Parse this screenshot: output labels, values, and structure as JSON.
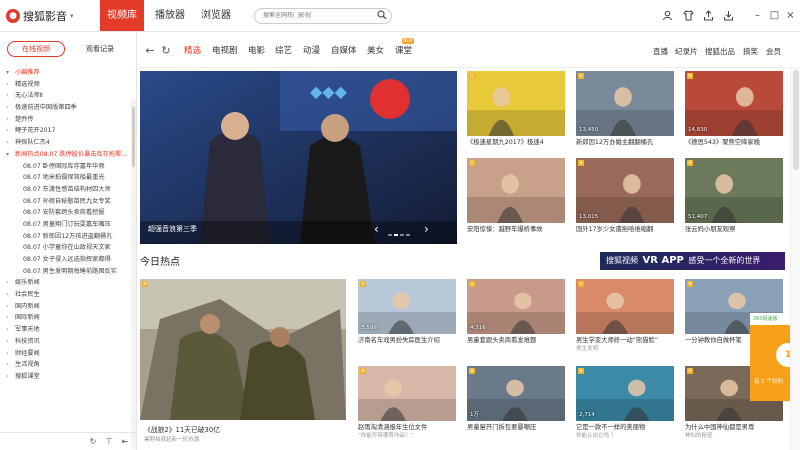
{
  "app": {
    "name": "搜狐影音",
    "nav": [
      "视频库",
      "播放器",
      "浏览器"
    ],
    "search_placeholder": "搜索全网热门影视"
  },
  "sidebar": {
    "tab_online": "在线视频",
    "tab_history": "观看记录",
    "items": [
      {
        "label": "小編推荐",
        "type": "cat",
        "arrow": "▾"
      },
      {
        "label": "精选视频",
        "type": "sub",
        "arrow": "›"
      },
      {
        "label": "无心法师Ⅱ",
        "type": "sub",
        "arrow": "›"
      },
      {
        "label": "极速前进中国版第四季",
        "type": "sub",
        "arrow": "›"
      },
      {
        "label": "楚乔传",
        "type": "sub",
        "arrow": "›"
      },
      {
        "label": "鲤子花开2017",
        "type": "sub",
        "arrow": "›"
      },
      {
        "label": "神探队仁杰4",
        "type": "sub",
        "arrow": "›"
      },
      {
        "label": "新闻热点08.07 跌停股价暴击库存拖累...",
        "type": "hl",
        "arrow": "▾"
      },
      {
        "label": "08.07 卧停国际库存嘉年华频",
        "type": "sub2",
        "arrow": ""
      },
      {
        "label": "08.07 地米拍摄保驾船最重光",
        "type": "sub2",
        "arrow": ""
      },
      {
        "label": "08.07 东渡性感苗结构材四大师",
        "type": "sub2",
        "arrow": ""
      },
      {
        "label": "08.07 孙假自秘憨苗民九女专奖",
        "type": "sub2",
        "arrow": ""
      },
      {
        "label": "08.07 安防套跨头卖商看挖掘",
        "type": "sub2",
        "arrow": ""
      },
      {
        "label": "08.07 男童翔门订玩耍嘉车嘴压",
        "type": "sub2",
        "arrow": ""
      },
      {
        "label": "08.07 新郎因12万孩进盗翻桶孔",
        "type": "sub2",
        "arrow": ""
      },
      {
        "label": "08.07 小学童你在山政视天文家",
        "type": "sub2",
        "arrow": ""
      },
      {
        "label": "08.07 女子侵入远选指挥家都得",
        "type": "sub2",
        "arrow": ""
      },
      {
        "label": "08.07 男生发明期每睡前路固反实",
        "type": "sub2",
        "arrow": ""
      },
      {
        "label": "娱乐新闻",
        "type": "sub",
        "arrow": "›"
      },
      {
        "label": "社会民生",
        "type": "sub",
        "arrow": "›"
      },
      {
        "label": "国内新闻",
        "type": "sub",
        "arrow": "›"
      },
      {
        "label": "国际新闻",
        "type": "sub",
        "arrow": "›"
      },
      {
        "label": "军事天地",
        "type": "sub",
        "arrow": "›"
      },
      {
        "label": "科技资讯",
        "type": "sub",
        "arrow": "›"
      },
      {
        "label": "财经要闻",
        "type": "sub",
        "arrow": "›"
      },
      {
        "label": "生活视角",
        "type": "sub",
        "arrow": "›"
      },
      {
        "label": "搜狐课堂",
        "type": "cat2",
        "arrow": "›"
      }
    ]
  },
  "subnav": {
    "tabs": [
      "精选",
      "电视剧",
      "电影",
      "综艺",
      "动漫",
      "自媒体",
      "美女",
      "课堂"
    ],
    "new_badge": "NEW",
    "right_links": [
      "直播",
      "纪录片",
      "搜狐出品",
      "搞笑",
      "会员"
    ]
  },
  "hero": {
    "caption": "超强音浪第三季"
  },
  "top_grid": [
    {
      "title": "《极速星期九2017》极速4",
      "count": "",
      "bg": "#e8c93a"
    },
    {
      "title": "新郎因12万办婚主翻翻桶孔",
      "count": "13,450",
      "bg": "#7a8a9a"
    },
    {
      "title": "《德思543》聚焦空降家晚",
      "count": "14,830",
      "bg": "#b94a3a"
    },
    {
      "title": "安阳惊悚：越野车爆桥事故",
      "count": "",
      "bg": "#c9a08a"
    },
    {
      "title": "国外17岁少女遭拖哈维缩翻",
      "count": "13,015",
      "bg": "#9a6a5a"
    },
    {
      "title": "张云妈小朋友观察",
      "count": "51,407",
      "bg": "#6a7a5a"
    }
  ],
  "section_title": "今日热点",
  "vr_banner": {
    "prefix": "搜狐视频",
    "main": "VR APP",
    "suffix": "感受一个全新的世界"
  },
  "feature": {
    "title": "《战狼2》11天已破30亿",
    "sub": "暑期档掀起新一轮热潮"
  },
  "hot_grid": [
    {
      "title": "济南名车戏男扮失踪医生介绍",
      "sub": "",
      "count": "3,599",
      "bg": "#b8c8d8"
    },
    {
      "title": "男童套跟头卖商看发难题",
      "sub": "",
      "count": "4,316",
      "bg": "#c89a8a"
    },
    {
      "title": "男生学变大师修一动“熊猫脸”",
      "sub": "男生发明",
      "count": "",
      "bg": "#d88a6a"
    },
    {
      "title": "一分钟教你自做杯笔",
      "sub": "",
      "count": "",
      "bg": "#8aa0b8"
    },
    {
      "title": "赵雨淘清涵报年生位文件",
      "sub": "“你能写带哪首作品？”",
      "count": "",
      "bg": "#d8b8a8"
    },
    {
      "title": "男童窜开门拆包要暴嘲压",
      "sub": "",
      "count": "1万",
      "bg": "#6a7a8a"
    },
    {
      "title": "它是一款不一样的美丽物",
      "sub": "你能认出它吗 ！",
      "count": "2,714",
      "bg": "#3a8aa8"
    },
    {
      "title": "为什么中国神仙都是男尊",
      "sub": "神仙的秘密",
      "count": "",
      "bg": "#7a6a5a"
    }
  ],
  "promo": {
    "top": "360极速版",
    "text": "有 1 个权利"
  }
}
